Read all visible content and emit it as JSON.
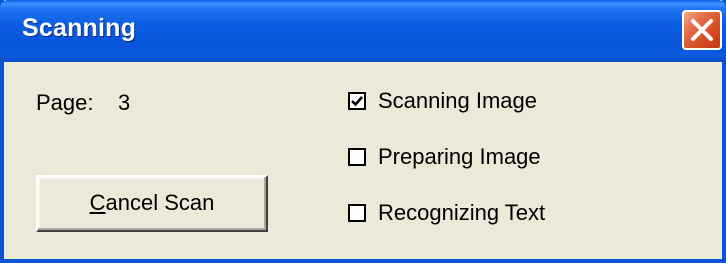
{
  "window": {
    "title": "Scanning",
    "close_icon": "close-x-icon"
  },
  "page": {
    "label": "Page:",
    "value": "3"
  },
  "cancel_button": {
    "mnemonic": "C",
    "rest": "ancel Scan"
  },
  "status_items": [
    {
      "label": "Scanning Image",
      "checked": true
    },
    {
      "label": "Preparing Image",
      "checked": false
    },
    {
      "label": "Recognizing Text",
      "checked": false
    }
  ],
  "colors": {
    "titlebar": "#0755d9",
    "close_button": "#d3481f",
    "dialog_background": "#ece9d8"
  }
}
